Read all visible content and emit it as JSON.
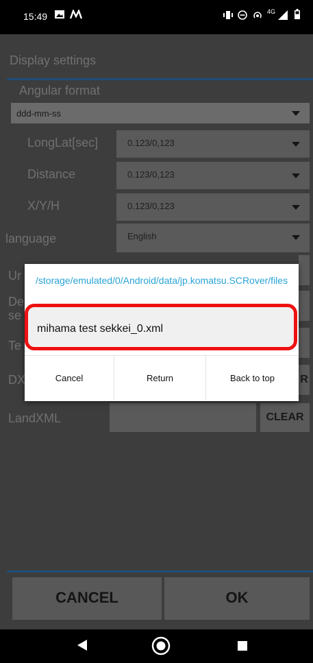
{
  "status_bar": {
    "time": "15:49",
    "icons": [
      "image-icon",
      "m-icon",
      "vibrate-icon",
      "dnd-icon",
      "hotspot-icon",
      "4g-icon",
      "signal-icon",
      "battery-icon"
    ],
    "network": "4G"
  },
  "settings": {
    "title": "Display settings",
    "angular_format": {
      "label": "Angular format",
      "value": "ddd-mm-ss"
    },
    "rows": [
      {
        "label": "LongLat[sec]",
        "value": "0.123/0,123"
      },
      {
        "label": "Distance",
        "value": "0.123/0,123"
      },
      {
        "label": "X/Y/H",
        "value": "0.123/0,123"
      }
    ],
    "language": {
      "label": "language",
      "value": "English"
    },
    "partial_labels": {
      "u": "Ur",
      "de": "De",
      "se": "se",
      "te": "Te",
      "dx": "DX"
    },
    "landxml": {
      "label": "LandXML",
      "clear": "CLEAR"
    },
    "dx_clear_fragment": "R",
    "cancel": "CANCEL",
    "ok": "OK"
  },
  "dialog": {
    "path": "/storage/emulated/0/Android/data/jp.komatsu.SCRover/files",
    "file_name": "mihama test sekkei_0.xml",
    "buttons": {
      "cancel": "Cancel",
      "return": "Return",
      "back_to_top": "Back to top"
    }
  },
  "colors": {
    "accent_blue": "#29a3d6",
    "highlight_red": "#e11111",
    "divider_blue": "#1f4d78"
  }
}
